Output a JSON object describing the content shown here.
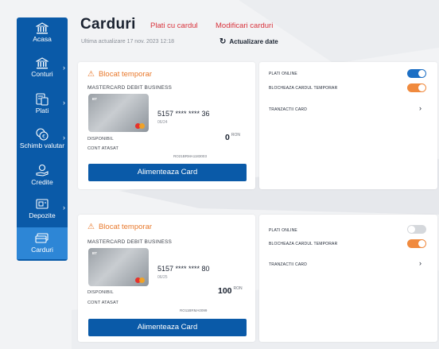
{
  "sidebar": {
    "items": [
      {
        "label": "Acasa",
        "icon": "bank-icon",
        "has_chevron": false,
        "active": false
      },
      {
        "label": "Conturi",
        "icon": "bank-icon",
        "has_chevron": true,
        "active": false
      },
      {
        "label": "Plati",
        "icon": "payment-icon",
        "has_chevron": true,
        "active": false
      },
      {
        "label": "Schimb valutar",
        "icon": "currency-exchange-icon",
        "has_chevron": true,
        "active": false
      },
      {
        "label": "Credite",
        "icon": "credit-hand-icon",
        "has_chevron": false,
        "active": false
      },
      {
        "label": "Depozite",
        "icon": "deposit-icon",
        "has_chevron": true,
        "active": false
      },
      {
        "label": "Carduri",
        "icon": "card-icon",
        "has_chevron": false,
        "active": true
      }
    ]
  },
  "header": {
    "title": "Carduri",
    "links": [
      "Plati cu cardul",
      "Modificari carduri"
    ],
    "last_update": "Ultima actualizare 17 nov. 2023 12:18",
    "refresh_label": "Actualizare date"
  },
  "cards": [
    {
      "status": "Blocat temporar",
      "card_type": "MASTERCARD DEBIT BUSINESS",
      "card_number": "5157 **** **** 36",
      "expiry": "06/24",
      "available_label": "DISPONIBIL",
      "amount": "0",
      "currency": "RON",
      "account_label": "CONT ATASAT",
      "iban": "RO21BRMA1183003",
      "button_label": "Alimenteaza Card",
      "options": {
        "online_label": "PLATI ONLINE",
        "online_on": true,
        "block_label": "BLOCHEAZA CARDUL TEMPORAR",
        "block_on": true,
        "transactions_label": "TRANZACTII CARD"
      }
    },
    {
      "status": "Blocat temporar",
      "card_type": "MASTERCARD DEBIT BUSINESS",
      "card_number": "5157 **** **** 80",
      "expiry": "06/25",
      "available_label": "DISPONIBIL",
      "amount": "100",
      "currency": "RON",
      "account_label": "CONT ATASAT",
      "iban": "RO11BRMA0099",
      "button_label": "Alimenteaza Card",
      "options": {
        "online_label": "PLATI ONLINE",
        "online_on": false,
        "block_label": "BLOCHEAZA CARDUL TEMPORAR",
        "block_on": true,
        "transactions_label": "TRANZACTII CARD"
      }
    }
  ],
  "colors": {
    "primary": "#0a5aa8",
    "sidebar_active": "#2d86d6",
    "accent_red": "#d8323b",
    "warning_orange": "#e8782b",
    "toggle_blue": "#1c6fc4",
    "toggle_orange": "#f08a3e",
    "toggle_off": "#d5d8dc"
  }
}
